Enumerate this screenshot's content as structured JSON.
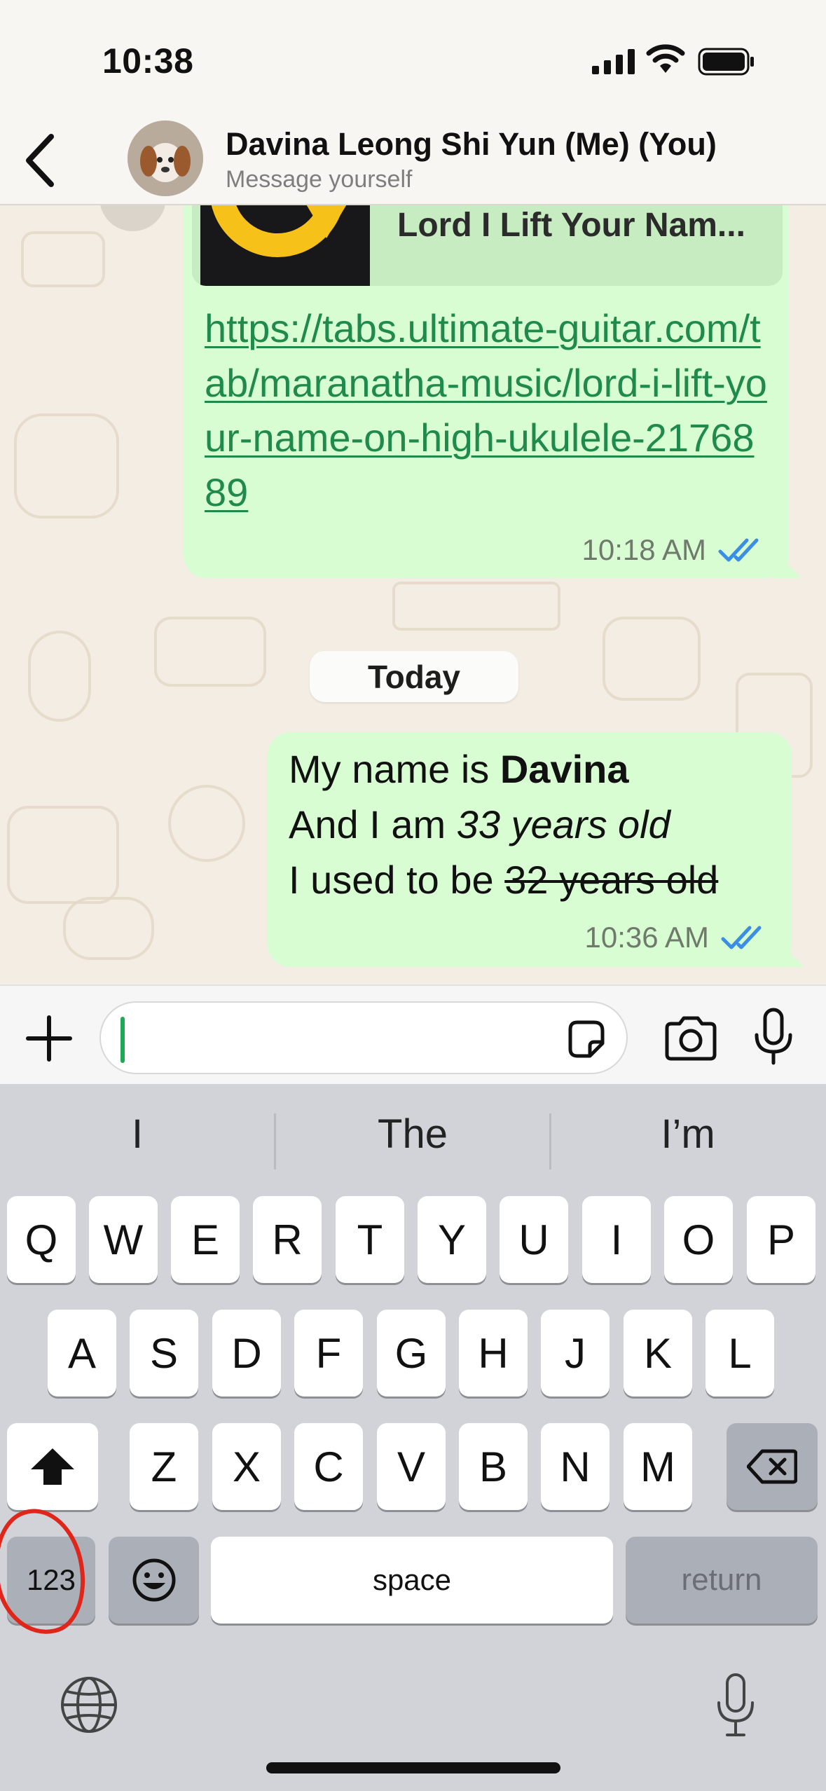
{
  "status_bar": {
    "time": "10:38"
  },
  "header": {
    "title": "Davina Leong Shi Yun (Me) (You)",
    "subtitle": "Message yourself"
  },
  "messages": [
    {
      "link_preview_title": "Lord I Lift Your Nam...",
      "link": "https://tabs.ultimate-guitar.com/tab/maranatha-music/lord-i-lift-your-name-on-high-ukulele-2176889",
      "time": "10:18 AM"
    },
    {
      "line1_plain": "My name is ",
      "line1_bold": "Davina",
      "line2_plain": "And I am ",
      "line2_italic": "33 years old",
      "line3_plain": "I used to be ",
      "line3_strike": "32 years old",
      "time": "10:36 AM"
    }
  ],
  "date_separator": "Today",
  "keyboard": {
    "suggestions": [
      "I",
      "The",
      "I’m"
    ],
    "row1": [
      "Q",
      "W",
      "E",
      "R",
      "T",
      "Y",
      "U",
      "I",
      "O",
      "P"
    ],
    "row2": [
      "A",
      "S",
      "D",
      "F",
      "G",
      "H",
      "J",
      "K",
      "L"
    ],
    "row3": [
      "Z",
      "X",
      "C",
      "V",
      "B",
      "N",
      "M"
    ],
    "numbers_label": "123",
    "space_label": "space",
    "return_label": "return"
  },
  "icons": {
    "read_receipt": "double-check-icon",
    "back": "chevron-left-icon",
    "plus": "plus-icon",
    "sticker": "sticker-icon",
    "camera": "camera-icon",
    "mic": "microphone-icon",
    "shift": "shift-icon",
    "delete": "backspace-icon",
    "emoji": "emoji-icon",
    "globe": "globe-icon",
    "dictation": "dictation-icon"
  },
  "colors": {
    "bubble": "#d9fdd3",
    "link": "#1f8a4c",
    "read_ticks": "#3a8ee6",
    "annotation": "#e0261b"
  }
}
